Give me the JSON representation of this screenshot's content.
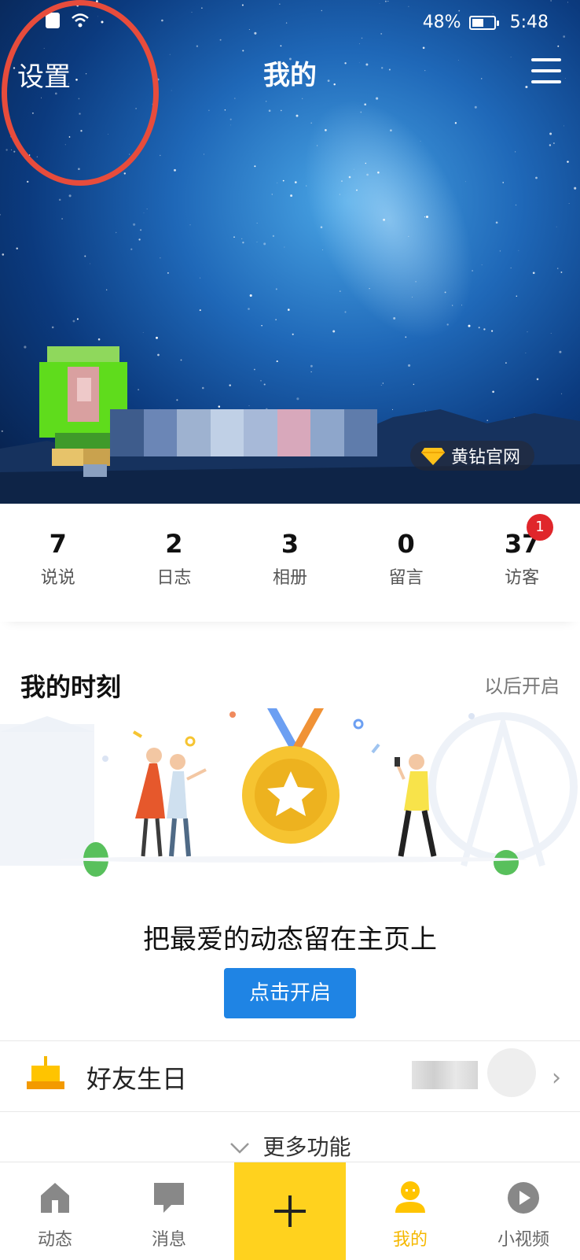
{
  "status_bar": {
    "battery": "48%",
    "time": "5:48",
    "battery_level": 0.48
  },
  "header": {
    "settings_label": "设置",
    "title": "我的",
    "menu_icon": "hamburger-menu-icon"
  },
  "profile": {
    "vip_label": "黄钻官网"
  },
  "stats": [
    {
      "value": "7",
      "label": "说说"
    },
    {
      "value": "2",
      "label": "日志"
    },
    {
      "value": "3",
      "label": "相册"
    },
    {
      "value": "0",
      "label": "留言"
    },
    {
      "value": "37",
      "label": "访客",
      "badge": "1"
    }
  ],
  "moments": {
    "title": "我的时刻",
    "later_label": "以后开启",
    "promo_text": "把最爱的动态留在主页上",
    "button_label": "点击开启"
  },
  "birthday": {
    "label": "好友生日"
  },
  "more": {
    "label": "更多功能"
  },
  "tabbar": [
    {
      "label": "动态",
      "icon": "house-icon"
    },
    {
      "label": "消息",
      "icon": "message-icon"
    },
    {
      "label": "",
      "icon": "plus-icon"
    },
    {
      "label": "我的",
      "icon": "person-icon",
      "active": true
    },
    {
      "label": "小视频",
      "icon": "play-icon"
    }
  ],
  "colors": {
    "accent_yellow": "#ffd21e",
    "button_blue": "#1f84e4",
    "badge_red": "#e0262b",
    "annotation_red": "#e74c3c"
  }
}
